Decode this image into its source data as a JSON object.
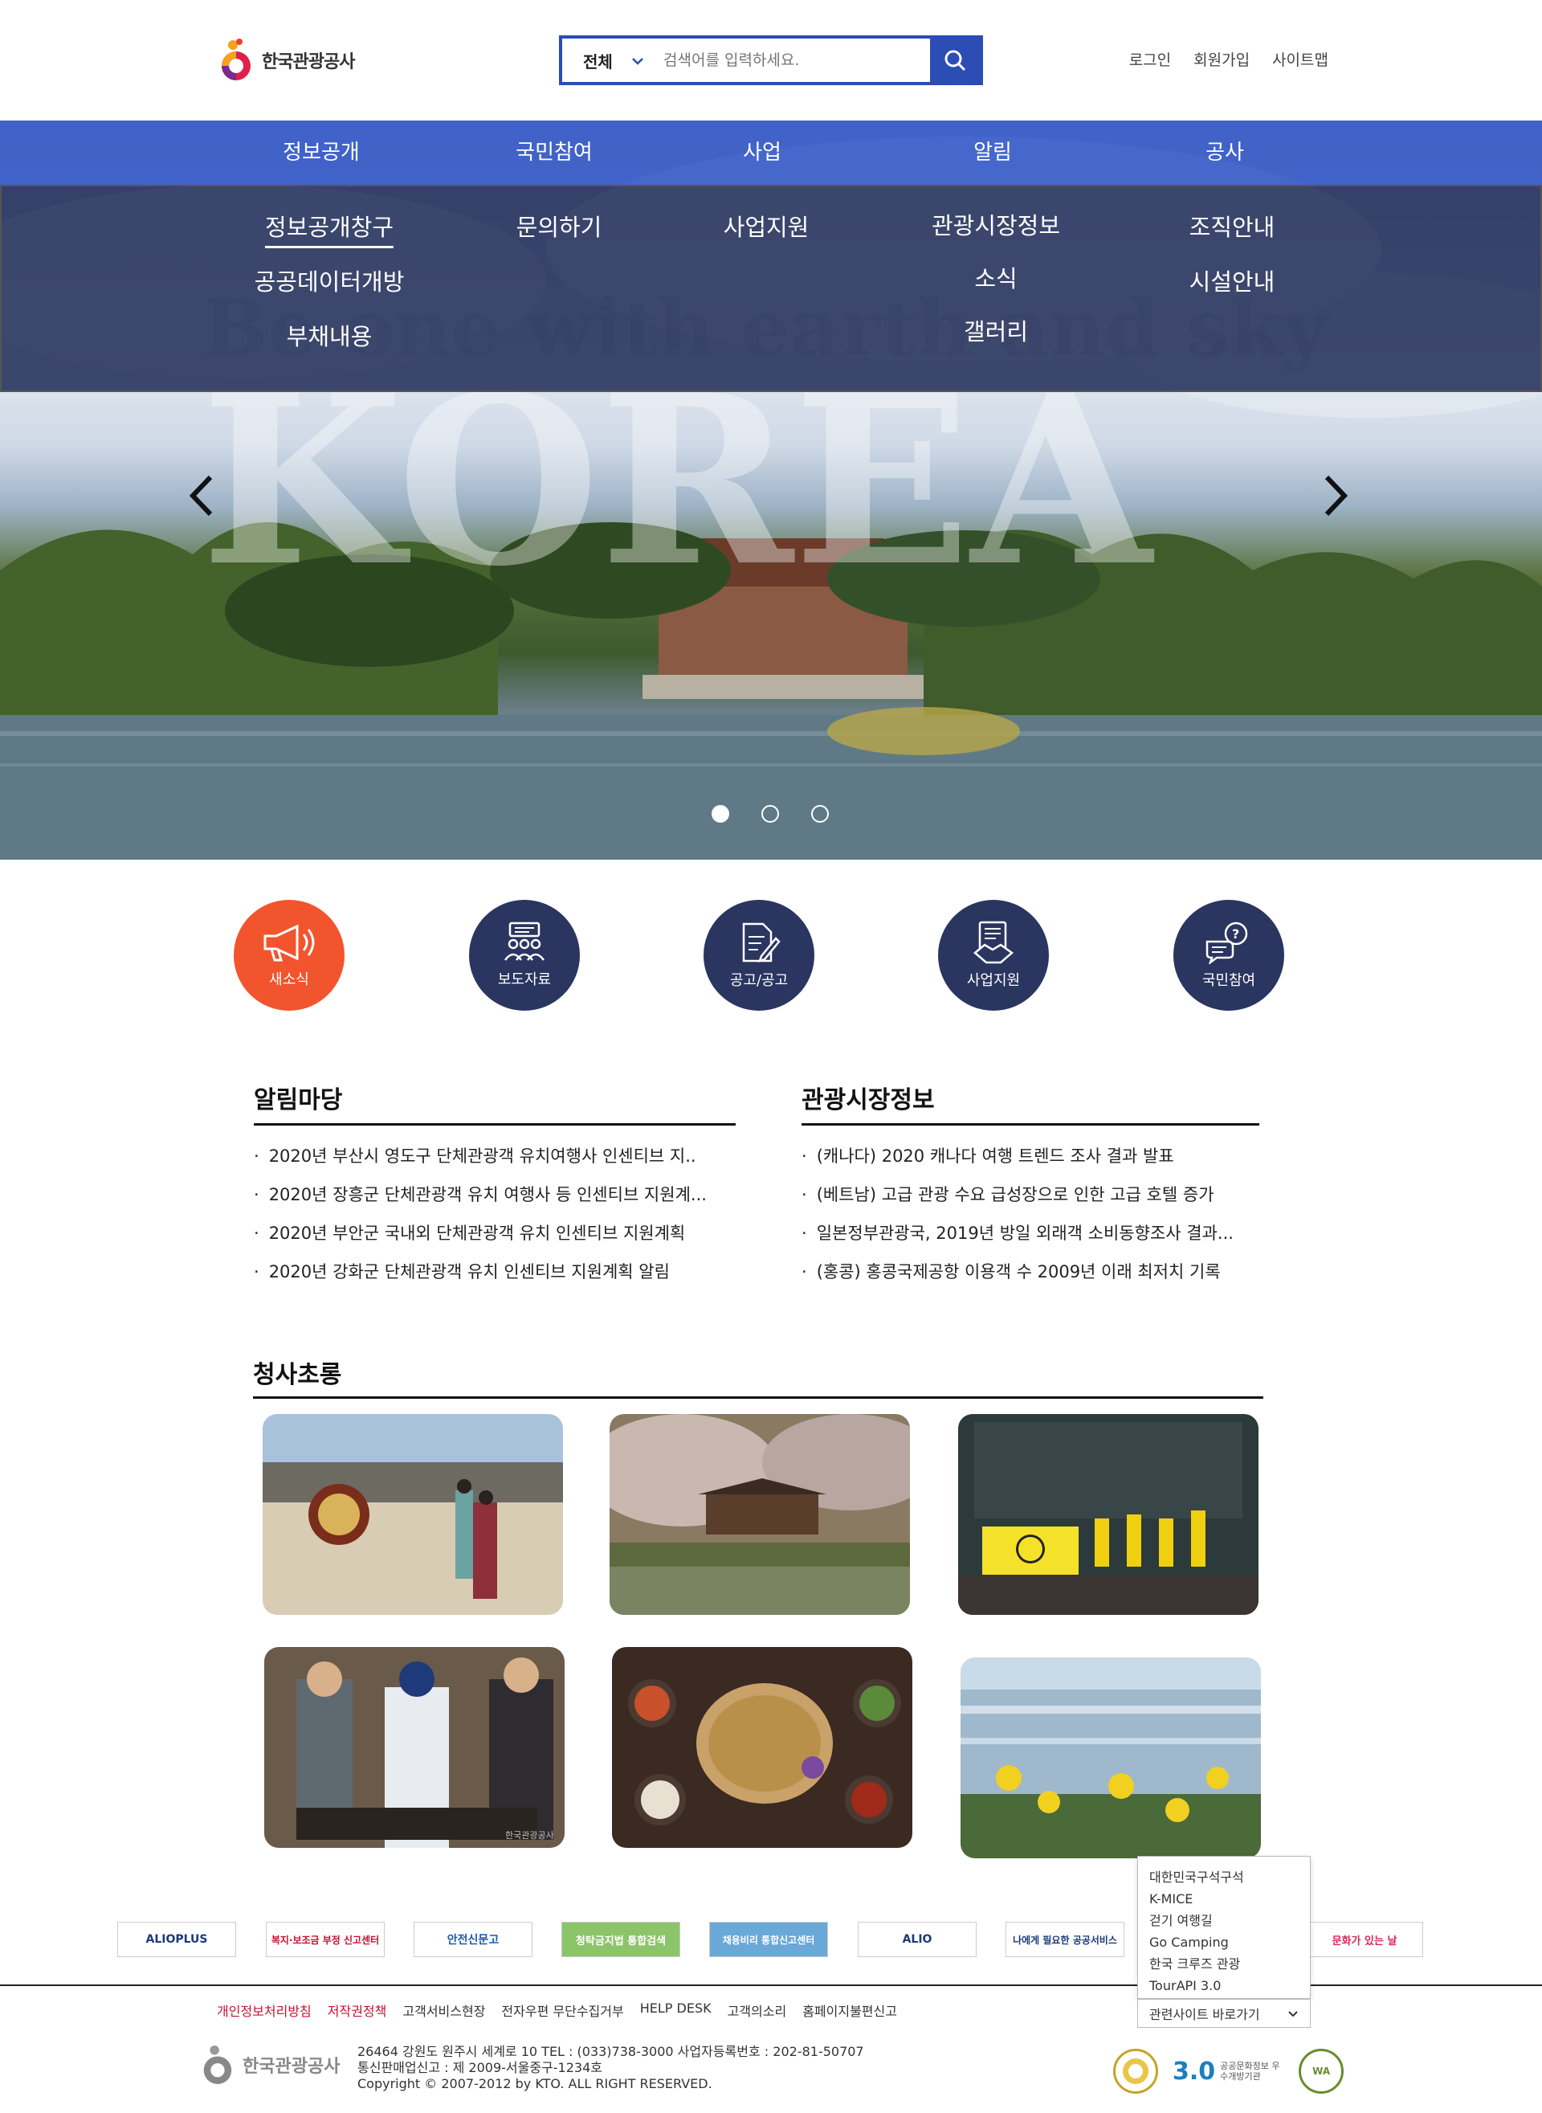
{
  "header": {
    "logo_text": "한국관광공사",
    "search": {
      "category": "전체",
      "placeholder": "검색어를 입력하세요."
    },
    "util_links": [
      "로그인",
      "회원가입",
      "사이트맵"
    ]
  },
  "gnb": [
    "정보공개",
    "국민참여",
    "사업",
    "알림",
    "공사"
  ],
  "submenu": {
    "col1": [
      "정보공개창구",
      "공공데이터개방",
      "부채내용"
    ],
    "col2": [
      "문의하기"
    ],
    "col3": [
      "사업지원"
    ],
    "col4": [
      "관광시장정보",
      "소식",
      "갤러리"
    ],
    "col5": [
      "조직안내",
      "시설안내"
    ]
  },
  "hero": {
    "headline": "Be one with earth and sky",
    "big_text": "KOREA",
    "prev_icon": "chevron-left-icon",
    "next_icon": "chevron-right-icon",
    "slide_count": 3,
    "active_slide": 1
  },
  "quick_menu": [
    "새소식",
    "보도자료",
    "공고/공고",
    "사업지원",
    "국민참여"
  ],
  "notice": {
    "title": "알림마당",
    "items": [
      "2020년 부산시 영도구 단체관광객 유치여행사 인센티브 지..",
      "2020년 장흥군 단체관광객 유치 여행사 등 인센티브 지원계...",
      "2020년 부안군 국내외 단체관광객 유치 인센티브 지원계획",
      "2020년 강화군 단체관광객 유치 인센티브 지원계획 알림"
    ]
  },
  "market": {
    "title": "관광시장정보",
    "items": [
      "(캐나다) 2020 캐나다 여행 트렌드 조사 결과 발표",
      "(베트남) 고급 관광 수요 급성장으로 인한 고급 호텔 증가",
      "일본정부관광국, 2019년 방일 외래객 소비동향조사 결과...",
      "(홍콩) 홍콩국제공항 이용객 수 2009년 이래 최저치 기록"
    ]
  },
  "gallery": {
    "title": "청사초롱",
    "watermark": "한국관광공사"
  },
  "banners": [
    "ALIOPLUS",
    "복지·보조금 부정 신고센터",
    "안전신문고",
    "청탁금지법 통합검색",
    "채용비리 통합신고센터",
    "ALIO",
    "나에게 필요한 공공서비스",
    "문화가 있는 날"
  ],
  "related_sites": {
    "items": [
      "대한민국구석구석",
      "K-MICE",
      "걷기 여행길",
      "Go Camping",
      "한국 크루즈 관광",
      "TourAPI 3.0"
    ],
    "select_label": "관련사이트 바로가기"
  },
  "footer": {
    "links": [
      "개인정보처리방침",
      "저작권정책",
      "고객서비스현장",
      "전자우편 무단수집거부",
      "HELP DESK",
      "고객의소리",
      "홈페이지불편신고"
    ],
    "logo_text": "한국관광공사",
    "address": "26464 강원도 원주시 세계로 10 TEL : (033)738-3000 사업자등록번호 : 202-81-50707",
    "mail_order": "통신판매업신고 : 제 2009-서울중구-1234호",
    "copyright": "Copyright © 2007-2012 by KTO. ALL RIGHT RESERVED.",
    "mark_labels": [
      "3.0",
      "공공문화정보 우수개방기관",
      "WA"
    ]
  },
  "colors": {
    "primary": "#2b4db4",
    "gnb": "#3a5cc8",
    "dark_navy": "#2a3560",
    "accent": "#f2542d",
    "footer_red": "#c8102e"
  }
}
